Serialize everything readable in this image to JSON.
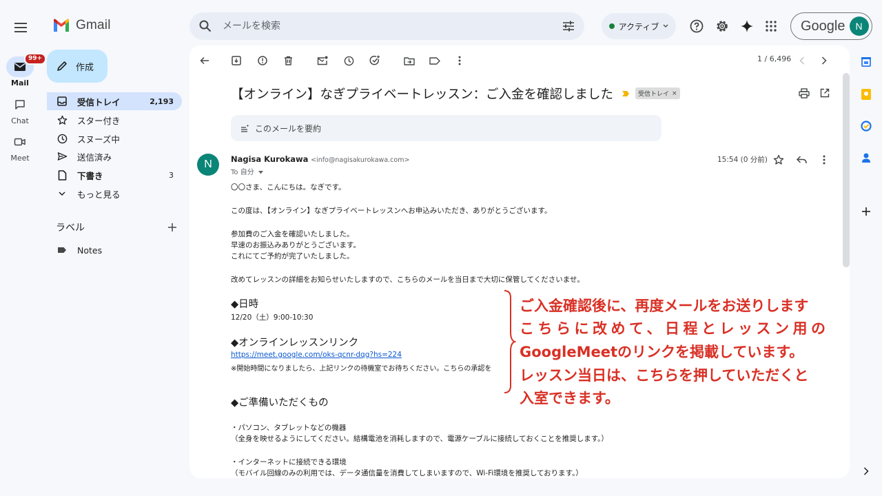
{
  "app": {
    "name": "Gmail"
  },
  "search": {
    "placeholder": "メールを検索"
  },
  "status": {
    "label": "アクティブ"
  },
  "account": {
    "brand": "Google",
    "initial": "N"
  },
  "rail": {
    "badge": "99+",
    "items": [
      {
        "label": "Mail"
      },
      {
        "label": "Chat"
      },
      {
        "label": "Meet"
      }
    ]
  },
  "sidebar": {
    "compose": "作成",
    "nav": [
      {
        "label": "受信トレイ",
        "count": "2,193"
      },
      {
        "label": "スター付き",
        "count": ""
      },
      {
        "label": "スヌーズ中",
        "count": ""
      },
      {
        "label": "送信済み",
        "count": ""
      },
      {
        "label": "下書き",
        "count": "3"
      },
      {
        "label": "もっと見る",
        "count": ""
      }
    ],
    "labels_title": "ラベル",
    "labels": [
      {
        "name": "Notes"
      }
    ]
  },
  "email": {
    "pager": "1 / 6,496",
    "subject": "【オンライン】なぎプライベートレッスン：ご入金を確認しました",
    "label_chip": "受信トレイ",
    "chip_close": "×",
    "summarize": "このメールを要約",
    "sender_name": "Nagisa Kurokawa",
    "sender_email": "<info@nagisakurokawa.com>",
    "to": "To 自分",
    "time": "15:54 (0 分前)",
    "body": {
      "greeting": "〇〇さま、こんにちは。なぎです。",
      "p1": "この度は、【オンライン】なぎプライベートレッスンへお申込みいただき、ありがとうございます。",
      "p2a": "参加費のご入金を確認いたしました。",
      "p2b": "早速のお振込みありがとうございます。",
      "p2c": "これにてご予約が完了いたしました。",
      "p3": "改めてレッスンの詳細をお知らせいたしますので、こちらのメールを当日まで大切に保管してくださいませ。",
      "h1": "◆日時",
      "datetime": "12/20（土）9:00-10:30",
      "h2": "◆オンラインレッスンリンク",
      "link": "https://meet.google.com/oks-qcnr-dqg?hs=224",
      "note": "※開始時間になりましたら、上記リンクの待機室でお待ちください。こちらの承認を",
      "h3": "◆ご準備いただくもの",
      "item1": "・パソコン、タブレットなどの機器",
      "item1_note": "（全身を映せるようにしてください。結構電池を消耗しますので、電源ケーブルに接続しておくことを推奨します。）",
      "item2": "・インターネットに接続できる環境",
      "item2_note": "（モバイル回線のみの利用では、データ通信量を消費してしまいますので、Wi-Fi環境を推奨しております。）"
    }
  },
  "annotation": {
    "lines": [
      "ご入金確認後に、再度メールをお送りします",
      "こちらに改めて、日程とレッスン用の",
      "GoogleMeetのリンクを掲載しています。",
      "レッスン当日は、こちらを押していただくと",
      "入室できます。"
    ]
  },
  "colors": {
    "accent": "#0b57d0",
    "annotation": "#d93025",
    "compose": "#c2e7ff",
    "selected": "#d3e3fd"
  }
}
